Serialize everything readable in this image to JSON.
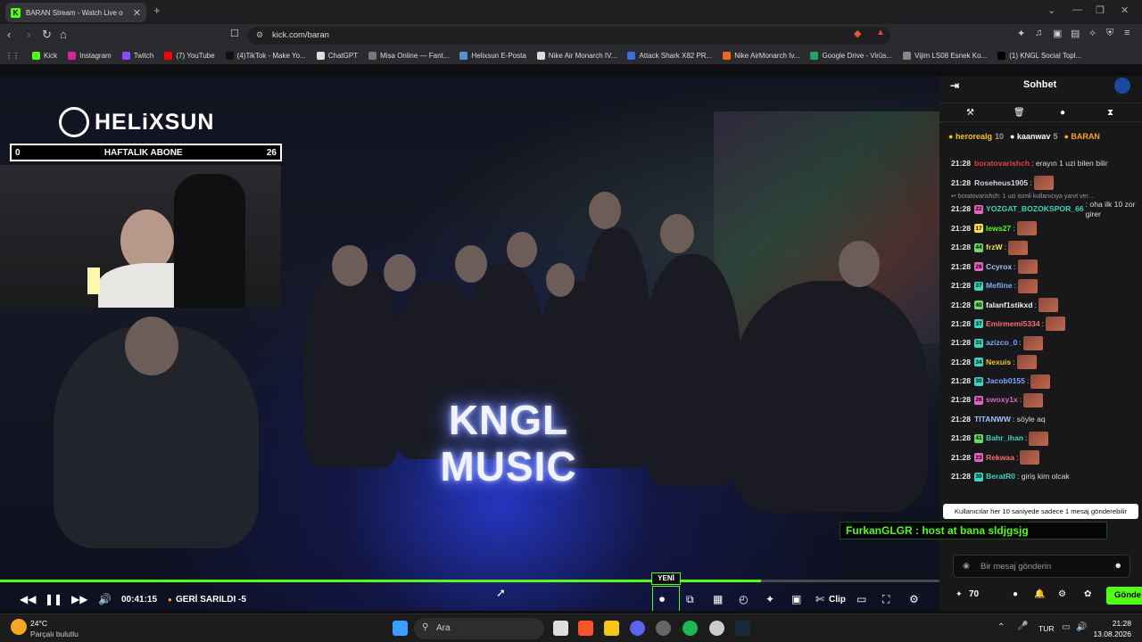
{
  "browser": {
    "tab_title": "BARAN Stream - Watch Live o",
    "tab_favicon": "K",
    "url": "kick.com/baran",
    "bookmarks": [
      {
        "label": "Kick",
        "color": "#53fc18"
      },
      {
        "label": "Instagram",
        "color": "#d6249f"
      },
      {
        "label": "Twitch",
        "color": "#9146ff"
      },
      {
        "label": "(7) YouTube",
        "color": "#ff0000"
      },
      {
        "label": "(4)TikTok - Make Yo...",
        "color": "#111111"
      },
      {
        "label": "ChatGPT",
        "color": "#dddddd"
      },
      {
        "label": "Misa Online — Fant...",
        "color": "#777777"
      },
      {
        "label": "Helixsun E-Posta",
        "color": "#5a8fd6"
      },
      {
        "label": "Nike Air Monarch IV...",
        "color": "#dddddd"
      },
      {
        "label": "Attack Shark X82 PR...",
        "color": "#3b6fd9"
      },
      {
        "label": "Nike AirMonarch Iv...",
        "color": "#f26522"
      },
      {
        "label": "Google Drive - Virüs...",
        "color": "#1fa463"
      },
      {
        "label": "Vijim LS08 Esnek Ko...",
        "color": "#888888"
      },
      {
        "label": "(1) KNGL Social Topl...",
        "color": "#000000"
      }
    ]
  },
  "overlay": {
    "brand": "HELiXSUN",
    "sub_left": "0",
    "sub_label": "HAFTALIK ABONE",
    "sub_right": "26",
    "neon_line1": "KNGL",
    "neon_line2": "MUSIC"
  },
  "player": {
    "time": "00:41:15",
    "rewind_label": "GERİ SARILDI -5",
    "new_badge": "YENİ",
    "clip_label": "Clip",
    "progress": 0.81
  },
  "chat": {
    "title": "Sohbet",
    "pinned": [
      {
        "name": "herorealg",
        "count": "10",
        "color": "#f5c518"
      },
      {
        "name": "kaanwav",
        "count": "5",
        "color": "#ffffff"
      },
      {
        "name": "BARAN",
        "count": "",
        "color": "#f5a623"
      }
    ],
    "messages": [
      {
        "time": "21:28",
        "badge": "",
        "badge_color": "",
        "user": "boratovarishch",
        "color": "#e0443d",
        "text": ": erayın 1 uzi bilen bilir",
        "emote": false
      },
      {
        "time": "21:28",
        "badge": "",
        "badge_color": "",
        "user": "Roseheus1905",
        "color": "#cfd8dc",
        "text": ":",
        "emote": true
      },
      {
        "time": "",
        "badge": "",
        "badge_color": "",
        "user": "",
        "color": "#999",
        "text": "↩ boratovarishch: 1 uzi isimli kullanıcıya yanıt ver...",
        "emote": false,
        "reply": true
      },
      {
        "time": "21:28",
        "badge": "22",
        "badge_color": "#e066c0",
        "user": "YOZGAT_BOZOKSPOR_66",
        "color": "#3fd4c0",
        "text": ": oha ilk 10 zor girer",
        "emote": false
      },
      {
        "time": "21:28",
        "badge": "17",
        "badge_color": "#f5e04a",
        "user": "lews27",
        "color": "#53fc18",
        "text": ":",
        "emote": true
      },
      {
        "time": "21:28",
        "badge": "44",
        "badge_color": "#6cd66c",
        "user": "frzW",
        "color": "#f5e04a",
        "text": ":",
        "emote": true
      },
      {
        "time": "21:28",
        "badge": "26",
        "badge_color": "#e066c0",
        "user": "Ccyrox",
        "color": "#9ec5ff",
        "text": ":",
        "emote": true
      },
      {
        "time": "21:28",
        "badge": "37",
        "badge_color": "#3fd4c0",
        "user": "Mefline",
        "color": "#7aa8ff",
        "text": ":",
        "emote": true
      },
      {
        "time": "21:28",
        "badge": "40",
        "badge_color": "#6cd66c",
        "user": "falanf1stikxd",
        "color": "#f0f0f0",
        "text": ":",
        "emote": true
      },
      {
        "time": "21:28",
        "badge": "37",
        "badge_color": "#3fd4c0",
        "user": "Emirmemi5334",
        "color": "#ff6b6b",
        "text": ":",
        "emote": true
      },
      {
        "time": "21:28",
        "badge": "31",
        "badge_color": "#3fd4c0",
        "user": "azizco_0",
        "color": "#7aa8ff",
        "text": ":",
        "emote": true
      },
      {
        "time": "21:28",
        "badge": "34",
        "badge_color": "#3fd4c0",
        "user": "Nexuis",
        "color": "#f5c518",
        "text": ":",
        "emote": true
      },
      {
        "time": "21:28",
        "badge": "30",
        "badge_color": "#3fd4c0",
        "user": "Jacob0155",
        "color": "#7aa8ff",
        "text": ":",
        "emote": true
      },
      {
        "time": "21:28",
        "badge": "26",
        "badge_color": "#e066c0",
        "user": "swoxy1x",
        "color": "#e066c0",
        "text": ":",
        "emote": true
      },
      {
        "time": "21:28",
        "badge": "",
        "badge_color": "",
        "user": "TITANWW",
        "color": "#9ec5ff",
        "text": ": söyle aq",
        "emote": false
      },
      {
        "time": "21:28",
        "badge": "41",
        "badge_color": "#6cd66c",
        "user": "Bahr_ihan",
        "color": "#3fd4c0",
        "text": ":",
        "emote": true
      },
      {
        "time": "21:28",
        "badge": "23",
        "badge_color": "#e066c0",
        "user": "Rekwaa",
        "color": "#ff6b6b",
        "text": ":",
        "emote": true
      },
      {
        "time": "21:28",
        "badge": "30",
        "badge_color": "#3fd4c0",
        "user": "BeratR0",
        "color": "#3fd4c0",
        "text": ": giriş kim olcak",
        "emote": false
      }
    ],
    "tooltip": "Kullanıcılar her 10 saniyede sadece 1 mesaj gönderebilir",
    "host_message": "FurkanGLGR : host at bana sldjgsjg",
    "input_placeholder": "Bir mesaj gönderin",
    "viewer_count": "70",
    "send_label": "Gönde"
  },
  "taskbar": {
    "weather_temp": "24°C",
    "weather_desc": "Parçalı bulutlu",
    "search_placeholder": "Ara",
    "lang": "TUR",
    "time": "21:28",
    "date": "13.08.2026"
  }
}
